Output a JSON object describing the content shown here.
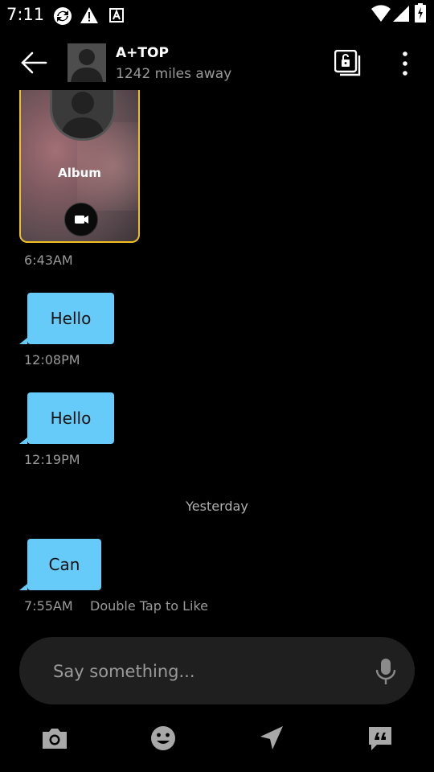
{
  "status_bar": {
    "time": "7:11",
    "icons": [
      "sync-icon",
      "warning-icon",
      "font-icon",
      "wifi-icon",
      "signal-icon",
      "battery-charging-icon"
    ]
  },
  "header": {
    "contact_name": "A+TOP",
    "distance": "1242 miles away",
    "icons": [
      "back-arrow-icon",
      "album-lock-icon",
      "more-vert-icon"
    ]
  },
  "album": {
    "label": "Album",
    "time": "6:43AM",
    "border_color": "#f0c022"
  },
  "messages": [
    {
      "text": "Hello",
      "time": "12:08PM"
    },
    {
      "text": "Hello",
      "time": "12:19PM"
    },
    {
      "text": "Can",
      "time": "7:55AM",
      "hint": "Double Tap to Like"
    }
  ],
  "day_separator": "Yesterday",
  "composer": {
    "placeholder": "Say something..."
  },
  "toolbar": {
    "icons": [
      "camera-icon",
      "emoji-icon",
      "location-send-icon",
      "quote-icon"
    ]
  },
  "colors": {
    "bubble": "#66cbf9",
    "background": "#000000",
    "input_bg": "#1f1f1f"
  }
}
